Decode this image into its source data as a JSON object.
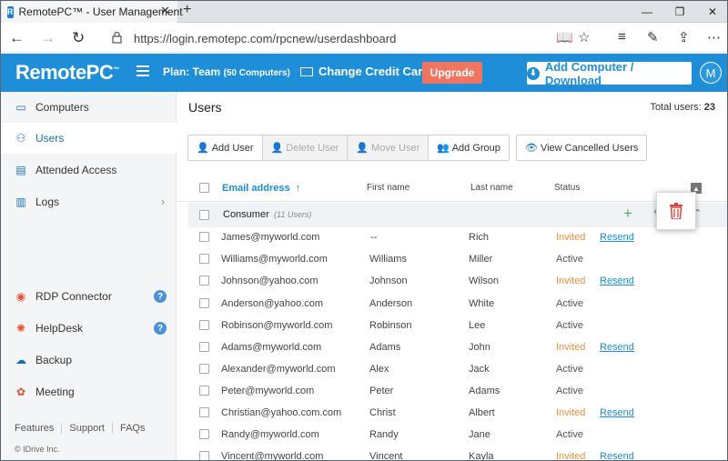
{
  "browser": {
    "tab_title": "RemotePC™ - User Management",
    "favicon_letter": "R",
    "url": "https://login.remotepc.com/rpcnew/userdashboard"
  },
  "header": {
    "logo": "RemotePC",
    "logo_tm": "™",
    "plan_label": "Plan: Team",
    "plan_detail": "(50 Computers)",
    "change_card": "Change Credit Card",
    "upgrade": "Upgrade",
    "add_computer": "Add Computer / Download",
    "avatar_letter": "M"
  },
  "sidebar": {
    "items": [
      {
        "label": "Computers"
      },
      {
        "label": "Users"
      },
      {
        "label": "Attended Access"
      },
      {
        "label": "Logs"
      },
      {
        "label": "RDP Connector"
      },
      {
        "label": "HelpDesk"
      },
      {
        "label": "Backup"
      },
      {
        "label": "Meeting"
      }
    ],
    "footer": [
      "Features",
      "Support",
      "FAQs"
    ],
    "copyright": "© IDrive Inc."
  },
  "main": {
    "title": "Users",
    "total_label": "Total users:",
    "total_value": "23",
    "toolbar": {
      "add_user": "Add User",
      "delete_user": "Delete User",
      "move_user": "Move User",
      "add_group": "Add Group",
      "view_cancelled": "View Cancelled Users"
    },
    "columns": {
      "email": "Email address",
      "first": "First name",
      "last": "Last name",
      "status": "Status"
    },
    "group": {
      "name": "Consumer",
      "count": "(11 Users)"
    },
    "rows": [
      {
        "email": "James@myworld.com",
        "first": "--",
        "last": "Rich",
        "status": "Invited",
        "action": "Resend"
      },
      {
        "email": "Williams@myworld.com",
        "first": "Williams",
        "last": "Miller",
        "status": "Active",
        "action": ""
      },
      {
        "email": "Johnson@yahoo.com",
        "first": "Johnson",
        "last": "Wilson",
        "status": "Invited",
        "action": "Resend"
      },
      {
        "email": "Anderson@yahoo.com",
        "first": "Anderson",
        "last": "White",
        "status": "Active",
        "action": ""
      },
      {
        "email": "Robinson@myworld.com",
        "first": "Robinson",
        "last": "Lee",
        "status": "Active",
        "action": ""
      },
      {
        "email": "Adams@myworld.com",
        "first": "Adams",
        "last": "John",
        "status": "Invited",
        "action": "Resend"
      },
      {
        "email": "Alexander@myworld.com",
        "first": "Alex",
        "last": "Jack",
        "status": "Active",
        "action": ""
      },
      {
        "email": "Peter@myworld.com",
        "first": "Peter",
        "last": "Adams",
        "status": "Active",
        "action": ""
      },
      {
        "email": "Christian@yahoo.com.com",
        "first": "Christ",
        "last": "Albert",
        "status": "Invited",
        "action": "Resend"
      },
      {
        "email": "Randy@myworld.com",
        "first": "Randy",
        "last": "Jane",
        "status": "Active",
        "action": ""
      },
      {
        "email": "Vincent@myworld.com",
        "first": "Vincent",
        "last": "Kayla",
        "status": "Invited",
        "action": "Resend"
      }
    ]
  },
  "colors": {
    "brand": "#1d8ed7",
    "upgrade": "#f07560",
    "invited": "#e8903b",
    "delete_icon": "#d9453b"
  }
}
